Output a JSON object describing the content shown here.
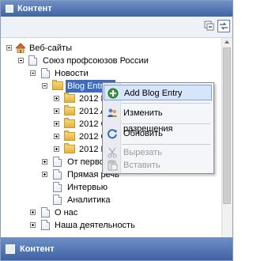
{
  "header": {
    "title": "Контент"
  },
  "toolbar": {
    "collapse_icon": "collapse-all-icon",
    "link_icon": "link-with-editor-icon"
  },
  "tree": {
    "root": "Веб-сайты",
    "site": "Союз профсоюзов России",
    "news": "Новости",
    "blog": "Blog Entries",
    "items": [
      "2012 M",
      "2012 A",
      "2012 C",
      "2012 O",
      "2012 H"
    ],
    "from_first": "От перво",
    "direct_speech": "Прямая речь",
    "interview": "Интервью",
    "analytics": "Аналитика",
    "about": "О нас",
    "activity": "Наша деятельность"
  },
  "context_menu": {
    "add_blog_entry": "Add Blog Entry",
    "change_permissions": "Изменить разрешения",
    "refresh": "Обновить",
    "cut": "Вырезать",
    "paste": "Вставить"
  },
  "footer": {
    "title": "Контент"
  }
}
